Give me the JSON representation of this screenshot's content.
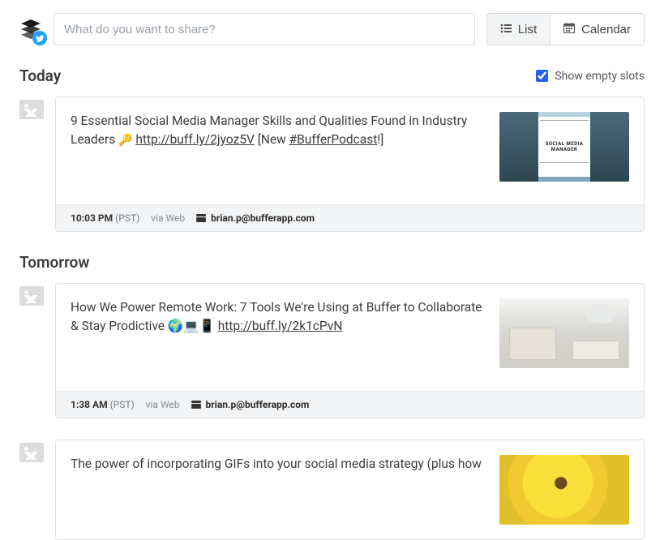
{
  "composer": {
    "placeholder": "What do you want to share?"
  },
  "view": {
    "list": "List",
    "calendar": "Calendar"
  },
  "show_empty_slots": {
    "label": "Show empty slots",
    "checked": true
  },
  "sections": {
    "today": {
      "title": "Today"
    },
    "tomorrow": {
      "title": "Tomorrow"
    }
  },
  "posts": [
    {
      "text_pre": "9 Essential Social Media Manager Skills and Qualities Found in Industry Leaders ",
      "emoji": "🔑",
      "link": "http://buff.ly/2jyoz5V",
      "text_mid": " [New ",
      "hashtag": "#BufferPodcast",
      "text_post": "!]",
      "time": "10:03 PM",
      "tz": "(PST)",
      "via": "via Web",
      "author": "brian.p@bufferapp.com"
    },
    {
      "text_pre": "How We Power Remote Work: 7 Tools We're Using at Buffer to Collaborate & Stay Prodictive ",
      "emojis": "🌍💻📱",
      "link": "http://buff.ly/2k1cPvN",
      "time": "1:38 AM",
      "tz": "(PST)",
      "via": "via Web",
      "author": "brian.p@bufferapp.com"
    },
    {
      "text_pre": "The power of incorporating GIFs into your social media strategy (plus how "
    }
  ]
}
